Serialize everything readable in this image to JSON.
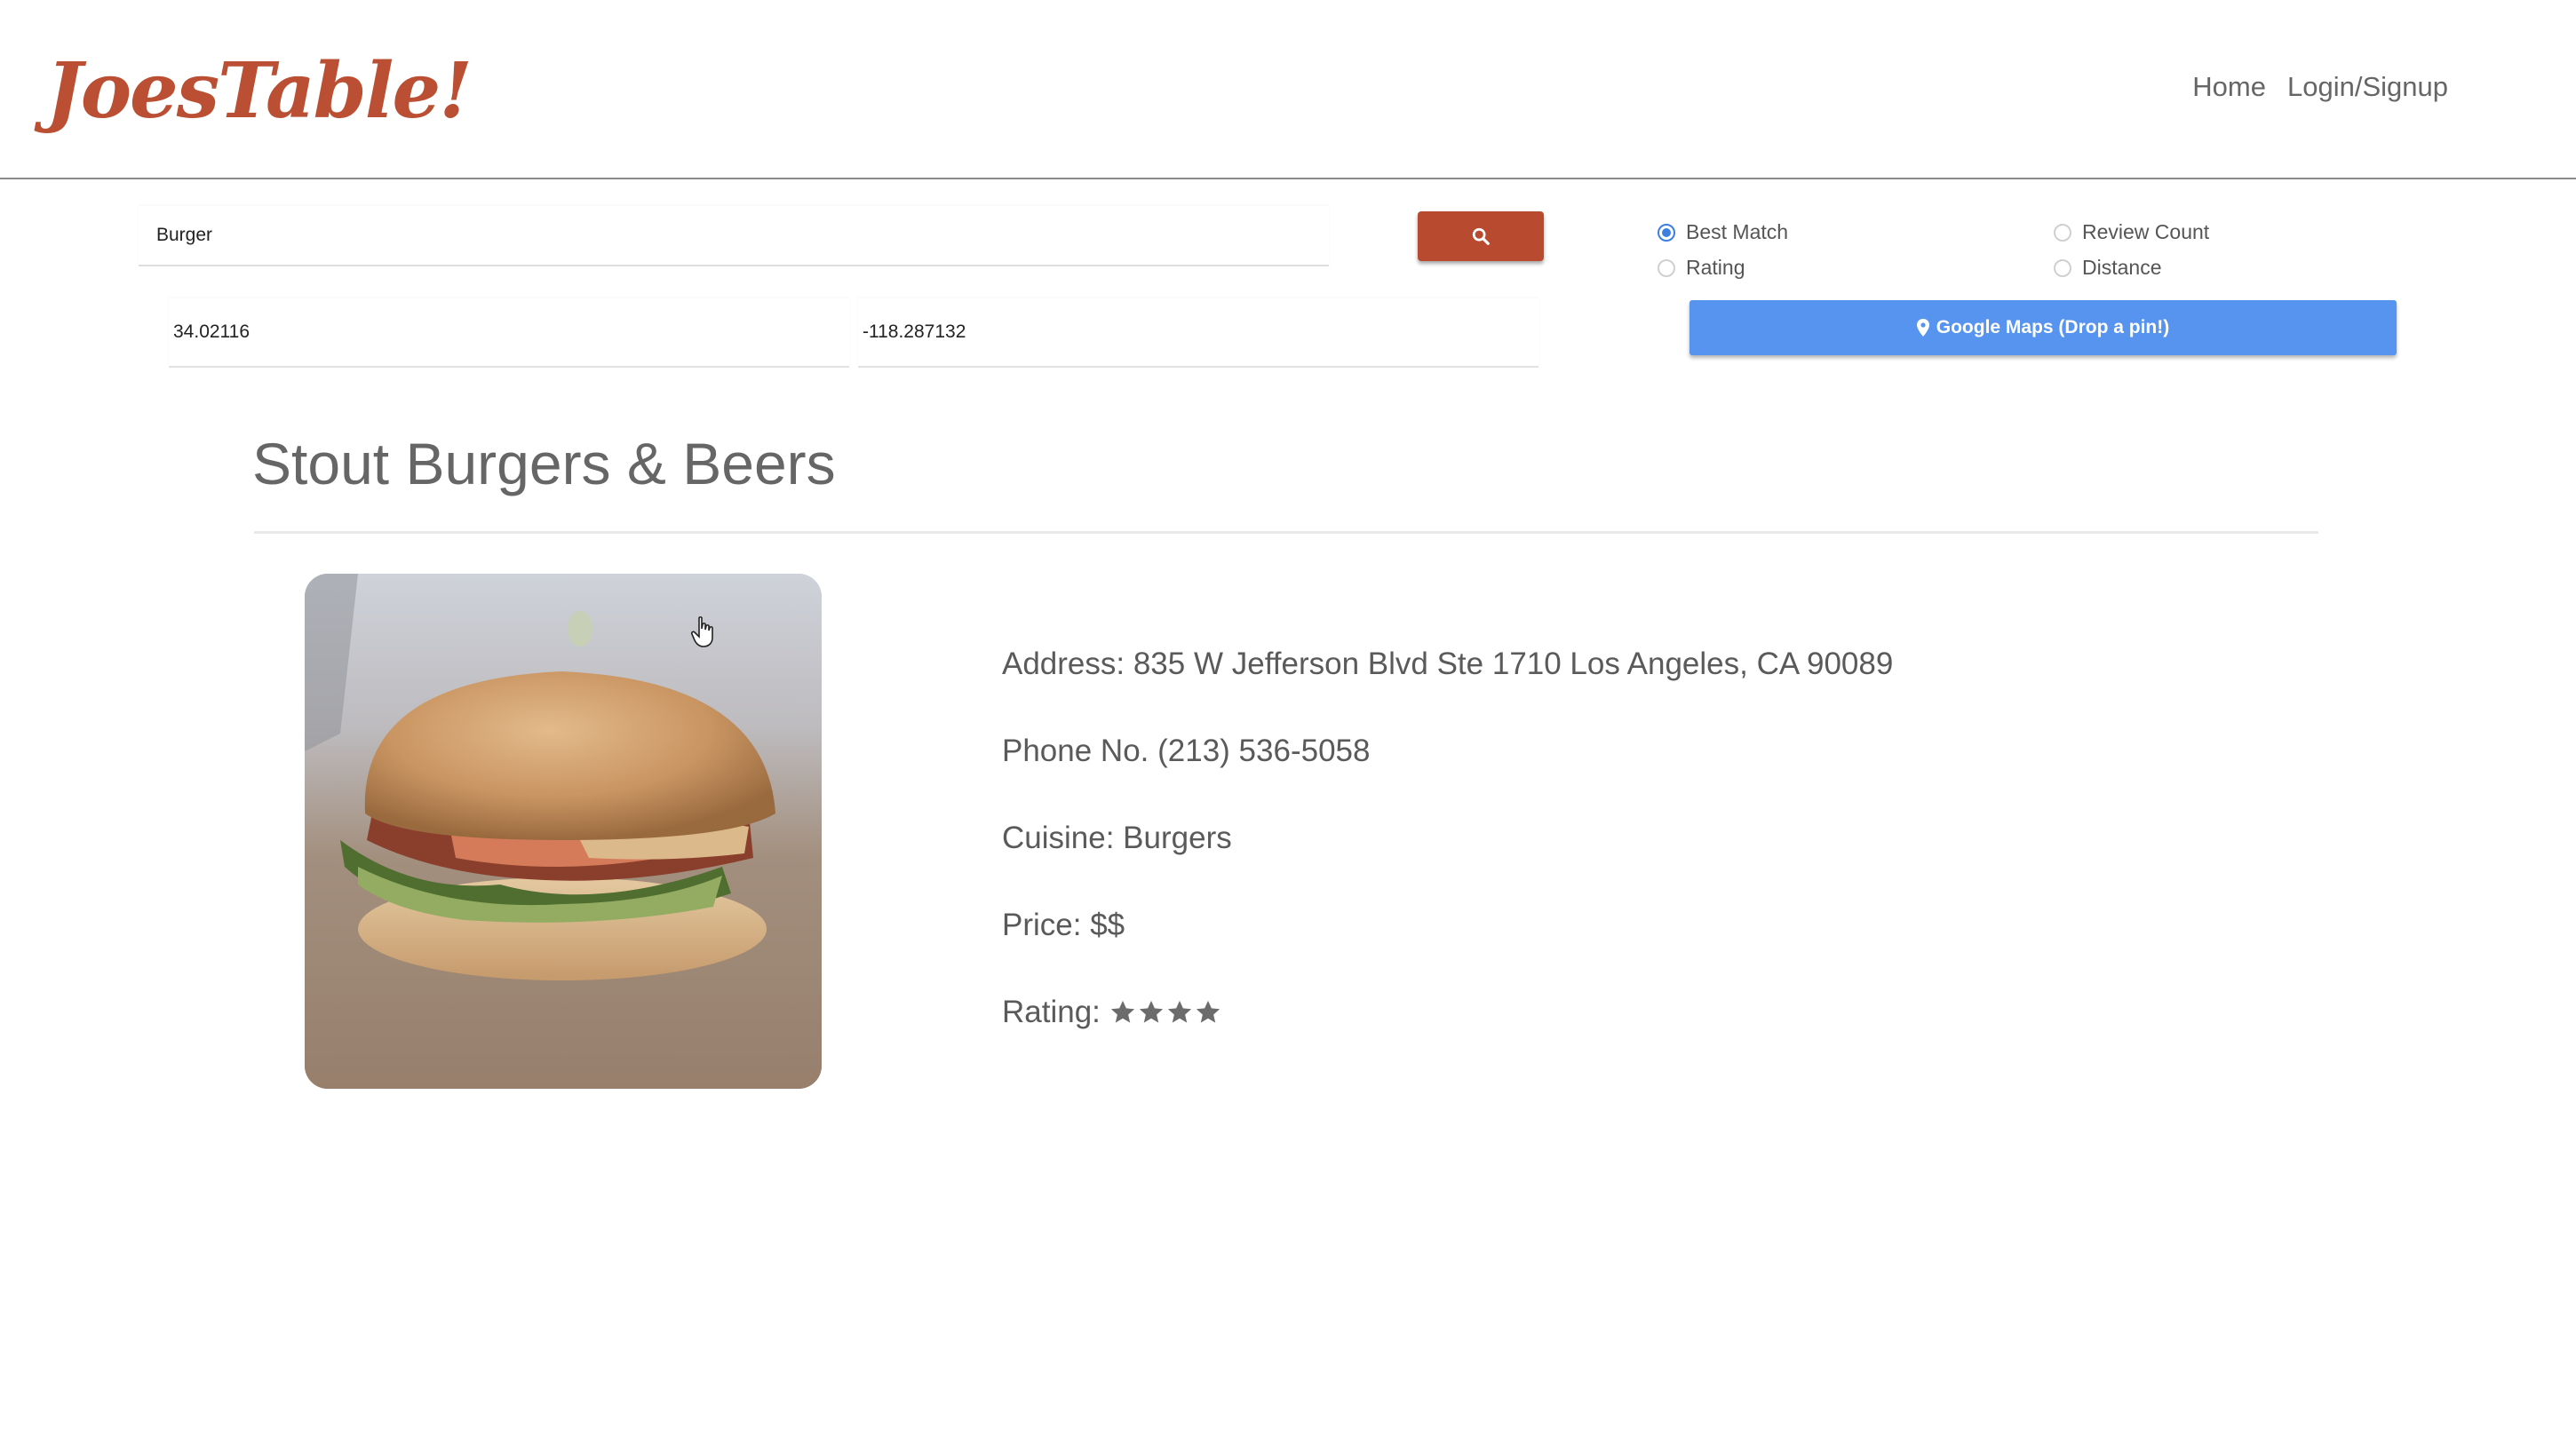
{
  "header": {
    "logo": "JoesTable!",
    "nav": {
      "home": "Home",
      "login": "Login/Signup"
    }
  },
  "search": {
    "query": "Burger",
    "latitude": "34.02116",
    "longitude": "-118.287132",
    "button_icon": "search-icon"
  },
  "sort_options": {
    "best_match": "Best Match",
    "review_count": "Review Count",
    "rating": "Rating",
    "distance": "Distance",
    "selected": "Best Match"
  },
  "maps_button": {
    "label": "Google Maps (Drop a pin!)",
    "icon": "map-marker-icon"
  },
  "restaurant": {
    "name": "Stout Burgers & Beers",
    "address": "Address: 835 W Jefferson Blvd Ste 1710 Los Angeles, CA 90089",
    "phone": "Phone No. (213) 536-5058",
    "cuisine": "Cuisine: Burgers",
    "price": "Price: $$",
    "rating_label": "Rating:",
    "rating_stars": 4,
    "photo_icon": "burger-photo"
  },
  "colors": {
    "brand": "#bb4f33",
    "search_button": "#b84a30",
    "maps_button": "#5794f0",
    "radio_selected": "#3d7fe0"
  }
}
